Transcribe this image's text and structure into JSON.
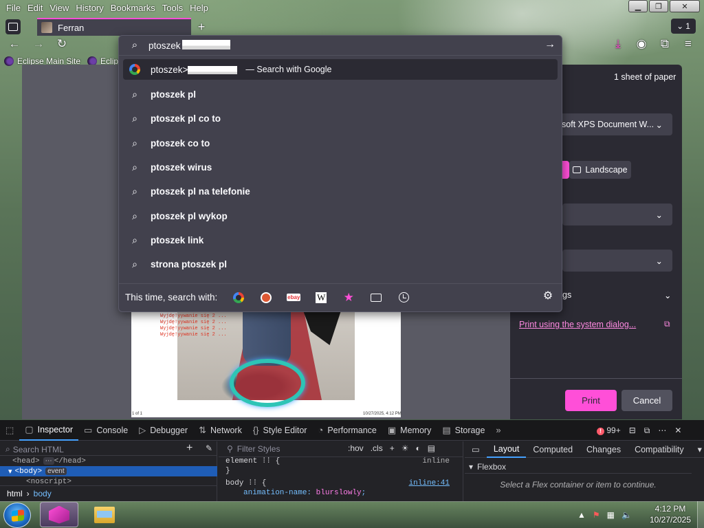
{
  "menubar": {
    "items": [
      "File",
      "Edit",
      "View",
      "History",
      "Bookmarks",
      "Tools",
      "Help"
    ]
  },
  "tabs": {
    "active_title": "Ferran",
    "list_count": "1"
  },
  "bookmarks": [
    {
      "label": "Eclipse Main Site"
    },
    {
      "label": "Eclips"
    }
  ],
  "urlbar": {
    "value": "ptoszek",
    "suggestions": [
      {
        "text": "ptoszek>",
        "action": "— Search with Google",
        "icon": "google-icon",
        "redacted": true
      },
      {
        "text": "ptoszek pl",
        "icon": "search-icon"
      },
      {
        "text": "ptoszek pl co to",
        "icon": "search-icon"
      },
      {
        "text": "ptoszek co to",
        "icon": "search-icon"
      },
      {
        "text": "ptoszek wirus",
        "icon": "search-icon"
      },
      {
        "text": "ptoszek pl na telefonie",
        "icon": "search-icon"
      },
      {
        "text": "ptoszek pl wykop",
        "icon": "search-icon"
      },
      {
        "text": "ptoszek link",
        "icon": "search-icon"
      },
      {
        "text": "strona ptoszek pl",
        "icon": "search-icon"
      }
    ],
    "engines_label": "This time, search with:",
    "engines": [
      "google-icon",
      "duckduckgo-icon",
      "ebay-icon",
      "wikipedia-icon",
      "bookmarks-icon",
      "tabs-icon",
      "history-icon"
    ]
  },
  "print_panel": {
    "sheets": "1 sheet of paper",
    "destination": "soft XPS Document W...",
    "landscape": "Landscape",
    "more_settings": "gs",
    "system_dialog": "Print using the system dialog...",
    "print": "Print",
    "cancel": "Cancel"
  },
  "preview": {
    "footer_left": "1 of 1",
    "footer_right": "10/27/2025, 4:12 PM"
  },
  "devtools": {
    "tabs": [
      "Inspector",
      "Console",
      "Debugger",
      "Network",
      "Style Editor",
      "Performance",
      "Memory",
      "Storage"
    ],
    "error_count": "99+",
    "search_placeholder": "Search HTML",
    "tree": {
      "head": "<head>",
      "head_close": "</head>",
      "body": "<body>",
      "body_badge": "event",
      "noscript": "<noscript>"
    },
    "breadcrumb": [
      "html",
      "body"
    ],
    "filter_placeholder": "Filter Styles",
    "filter_tools": [
      ":hov",
      ".cls"
    ],
    "rules": {
      "element_selector": "element",
      "element_src": "inline",
      "body_selector": "body",
      "body_src": "inline:41",
      "prop_name": "animation-name",
      "prop_value": "blurslowly"
    },
    "right_tabs": [
      "Layout",
      "Computed",
      "Changes",
      "Compatibility"
    ],
    "flexbox_label": "Flexbox",
    "flexbox_msg": "Select a Flex container or item to continue."
  },
  "taskbar": {
    "time": "4:12 PM",
    "date": "10/27/2025"
  }
}
